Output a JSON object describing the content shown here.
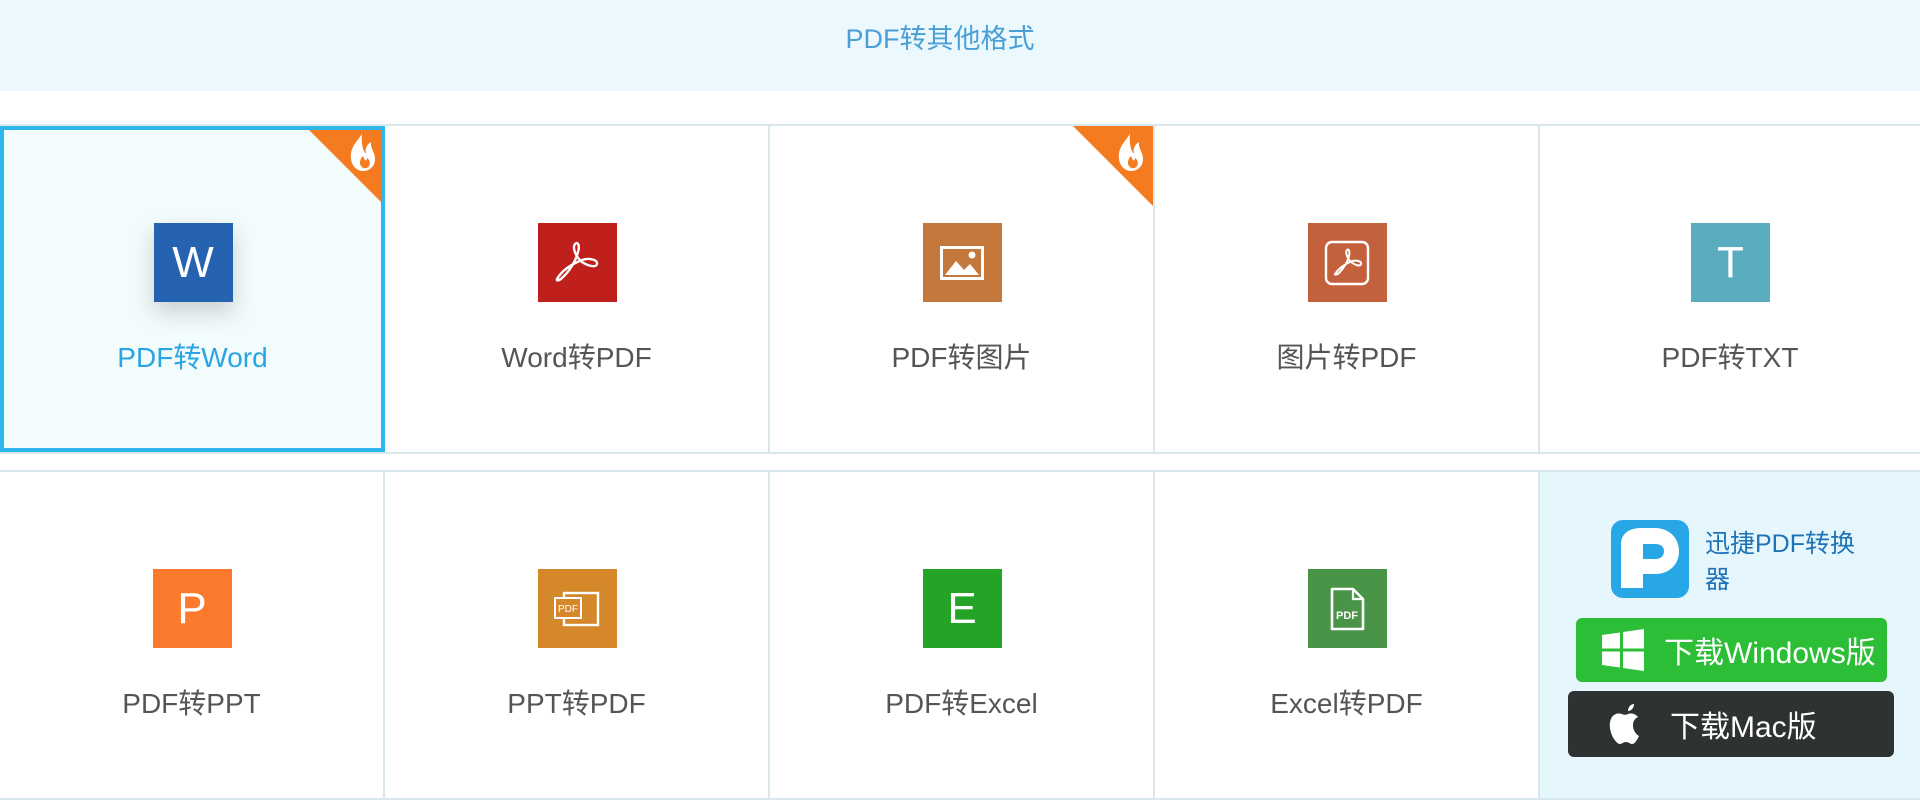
{
  "header": {
    "tab_title": "PDF转其他格式"
  },
  "tools_row1": [
    {
      "label": "PDF转Word",
      "icon": "word-icon",
      "icon_letter": "W",
      "color": "#2563b0",
      "hot": true,
      "active": true
    },
    {
      "label": "Word转PDF",
      "icon": "pdf-icon",
      "color": "#c0201c",
      "hot": false
    },
    {
      "label": "PDF转图片",
      "icon": "image-icon",
      "color": "#c5783c",
      "hot": true
    },
    {
      "label": "图片转PDF",
      "icon": "pdf-doc-icon",
      "color": "#c3613d",
      "hot": false
    },
    {
      "label": "PDF转TXT",
      "icon": "txt-icon",
      "icon_letter": "T",
      "color": "#5aadbf",
      "hot": false
    }
  ],
  "tools_row2": [
    {
      "label": "PDF转PPT",
      "icon": "ppt-icon",
      "icon_letter": "P",
      "color": "#fb7a2e"
    },
    {
      "label": "PPT转PDF",
      "icon": "ppt-pdf-icon",
      "icon_text": "PDF",
      "color": "#d4882a"
    },
    {
      "label": "PDF转Excel",
      "icon": "excel-icon",
      "icon_letter": "E",
      "color": "#24a327"
    },
    {
      "label": "Excel转PDF",
      "icon": "excel-pdf-icon",
      "icon_text": "PDF",
      "color": "#4a9448"
    }
  ],
  "promo": {
    "app_name": "迅捷PDF转换器",
    "app_icon": "xunjie-logo-icon",
    "download_windows": "下载Windows版",
    "download_mac": "下载Mac版",
    "windows_color": "#2dbe37",
    "mac_color": "#2f3232"
  },
  "colors": {
    "accent": "#2fb6ea",
    "hot_badge": "#f47b20",
    "header_bg": "#ebf9fe",
    "promo_bg": "#e6f6fd"
  }
}
